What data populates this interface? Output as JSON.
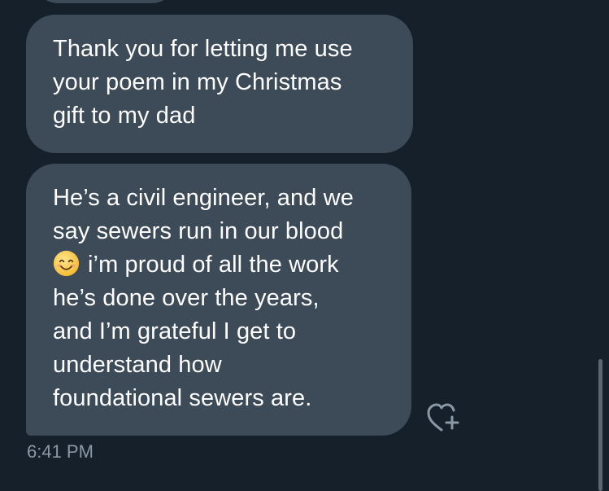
{
  "messages": [
    {
      "lines": [
        "Thank you for letting me use",
        "your poem in my Christmas",
        "gift to my dad"
      ]
    },
    {
      "lines": [
        "He’s a civil engineer, and we",
        "say sewers run in our blood",
        "i’m proud of all the work",
        "he’s done over the years,",
        "and I’m grateful I get to",
        "understand how",
        "foundational sewers are."
      ],
      "emoji": "smiling-face-with-smiling-eyes"
    }
  ],
  "timestamp": "6:41 PM",
  "icons": {
    "like": "heart-plus-icon"
  },
  "colors": {
    "background": "#15202b",
    "bubble": "#3d4a58",
    "text": "#ffffff",
    "timestamp": "#8b98a5"
  }
}
